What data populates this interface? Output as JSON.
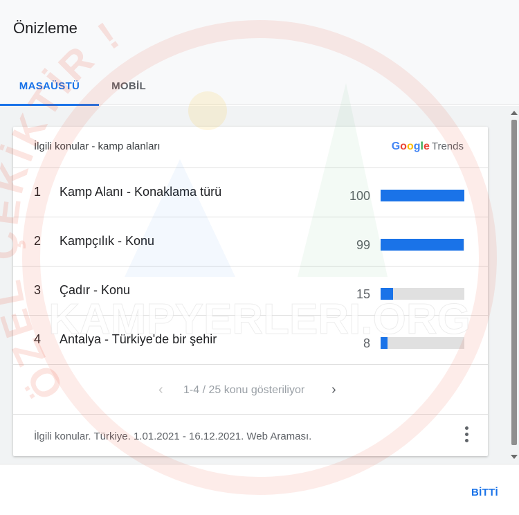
{
  "dialog": {
    "title": "Önizleme",
    "done_label": "BİTTİ"
  },
  "tabs": [
    {
      "label": "MASAÜSTÜ",
      "active": true
    },
    {
      "label": "MOBİL",
      "active": false
    }
  ],
  "card": {
    "title": "İlgili konular - kamp alanları",
    "logo": {
      "letters": [
        "G",
        "o",
        "o",
        "g",
        "l",
        "e"
      ],
      "trends": "Trends"
    },
    "rows": [
      {
        "rank": "1",
        "label": "Kamp Alanı - Konaklama türü",
        "value": 100
      },
      {
        "rank": "2",
        "label": "Kampçılık - Konu",
        "value": 99
      },
      {
        "rank": "3",
        "label": "Çadır - Konu",
        "value": 15
      },
      {
        "rank": "4",
        "label": "Antalya - Türkiye'de bir şehir",
        "value": 8
      }
    ],
    "pager": {
      "text": "1-4 / 25 konu gösteriliyor"
    },
    "footer": "İlgili konular. Türkiye. 1.01.2021 - 16.12.2021. Web Araması."
  },
  "watermark": {
    "text": "KAMPYERLERI.ORG",
    "arc_text": "ÖZEL ÇEKİKTİR !"
  },
  "colors": {
    "accent": "#1a73e8",
    "bar_track": "#e0e0e0",
    "google_blue": "#4285F4",
    "google_red": "#EA4335",
    "google_yellow": "#FBBC05",
    "google_green": "#34A853",
    "watermark_red": "#e8452c"
  }
}
